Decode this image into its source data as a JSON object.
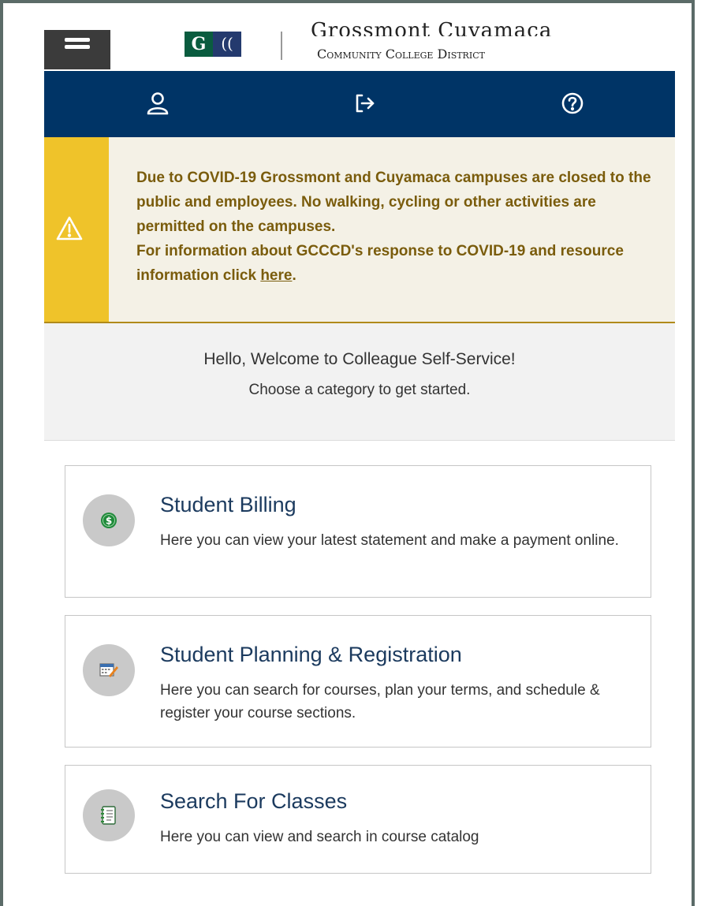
{
  "header": {
    "district_top": "Grossmont Cuyamaca",
    "district_name": "Community College District",
    "logo_left": "G",
    "logo_right": "(("
  },
  "navbar": {
    "icons": [
      "user-icon",
      "sign-out-icon",
      "help-icon"
    ]
  },
  "alert": {
    "line1": "Due to COVID-19 Grossmont and Cuyamaca campuses are closed to the public and employees. No walking, cycling or other activities are permitted on the campuses.",
    "line2_prefix": "For information about GCCCD's response to COVID-19 and resource information click ",
    "link_text": "here",
    "line2_suffix": "."
  },
  "welcome": {
    "title": "Hello, Welcome to Colleague Self-Service!",
    "subtitle": "Choose a category to get started."
  },
  "categories": [
    {
      "title": "Student Billing",
      "description": "Here you can view your latest statement and make a payment online.",
      "icon": "dollar-icon"
    },
    {
      "title": "Student Planning & Registration",
      "description": "Here you can search for courses, plan your terms, and schedule & register your course sections.",
      "icon": "calendar-icon"
    },
    {
      "title": "Search For Classes",
      "description": "Here you can view and search in course catalog",
      "icon": "catalog-icon"
    }
  ],
  "colors": {
    "navbar": "#003466",
    "alert_bar": "#efc32a",
    "alert_text": "#7a5c0c",
    "card_title": "#1b3a5e"
  }
}
